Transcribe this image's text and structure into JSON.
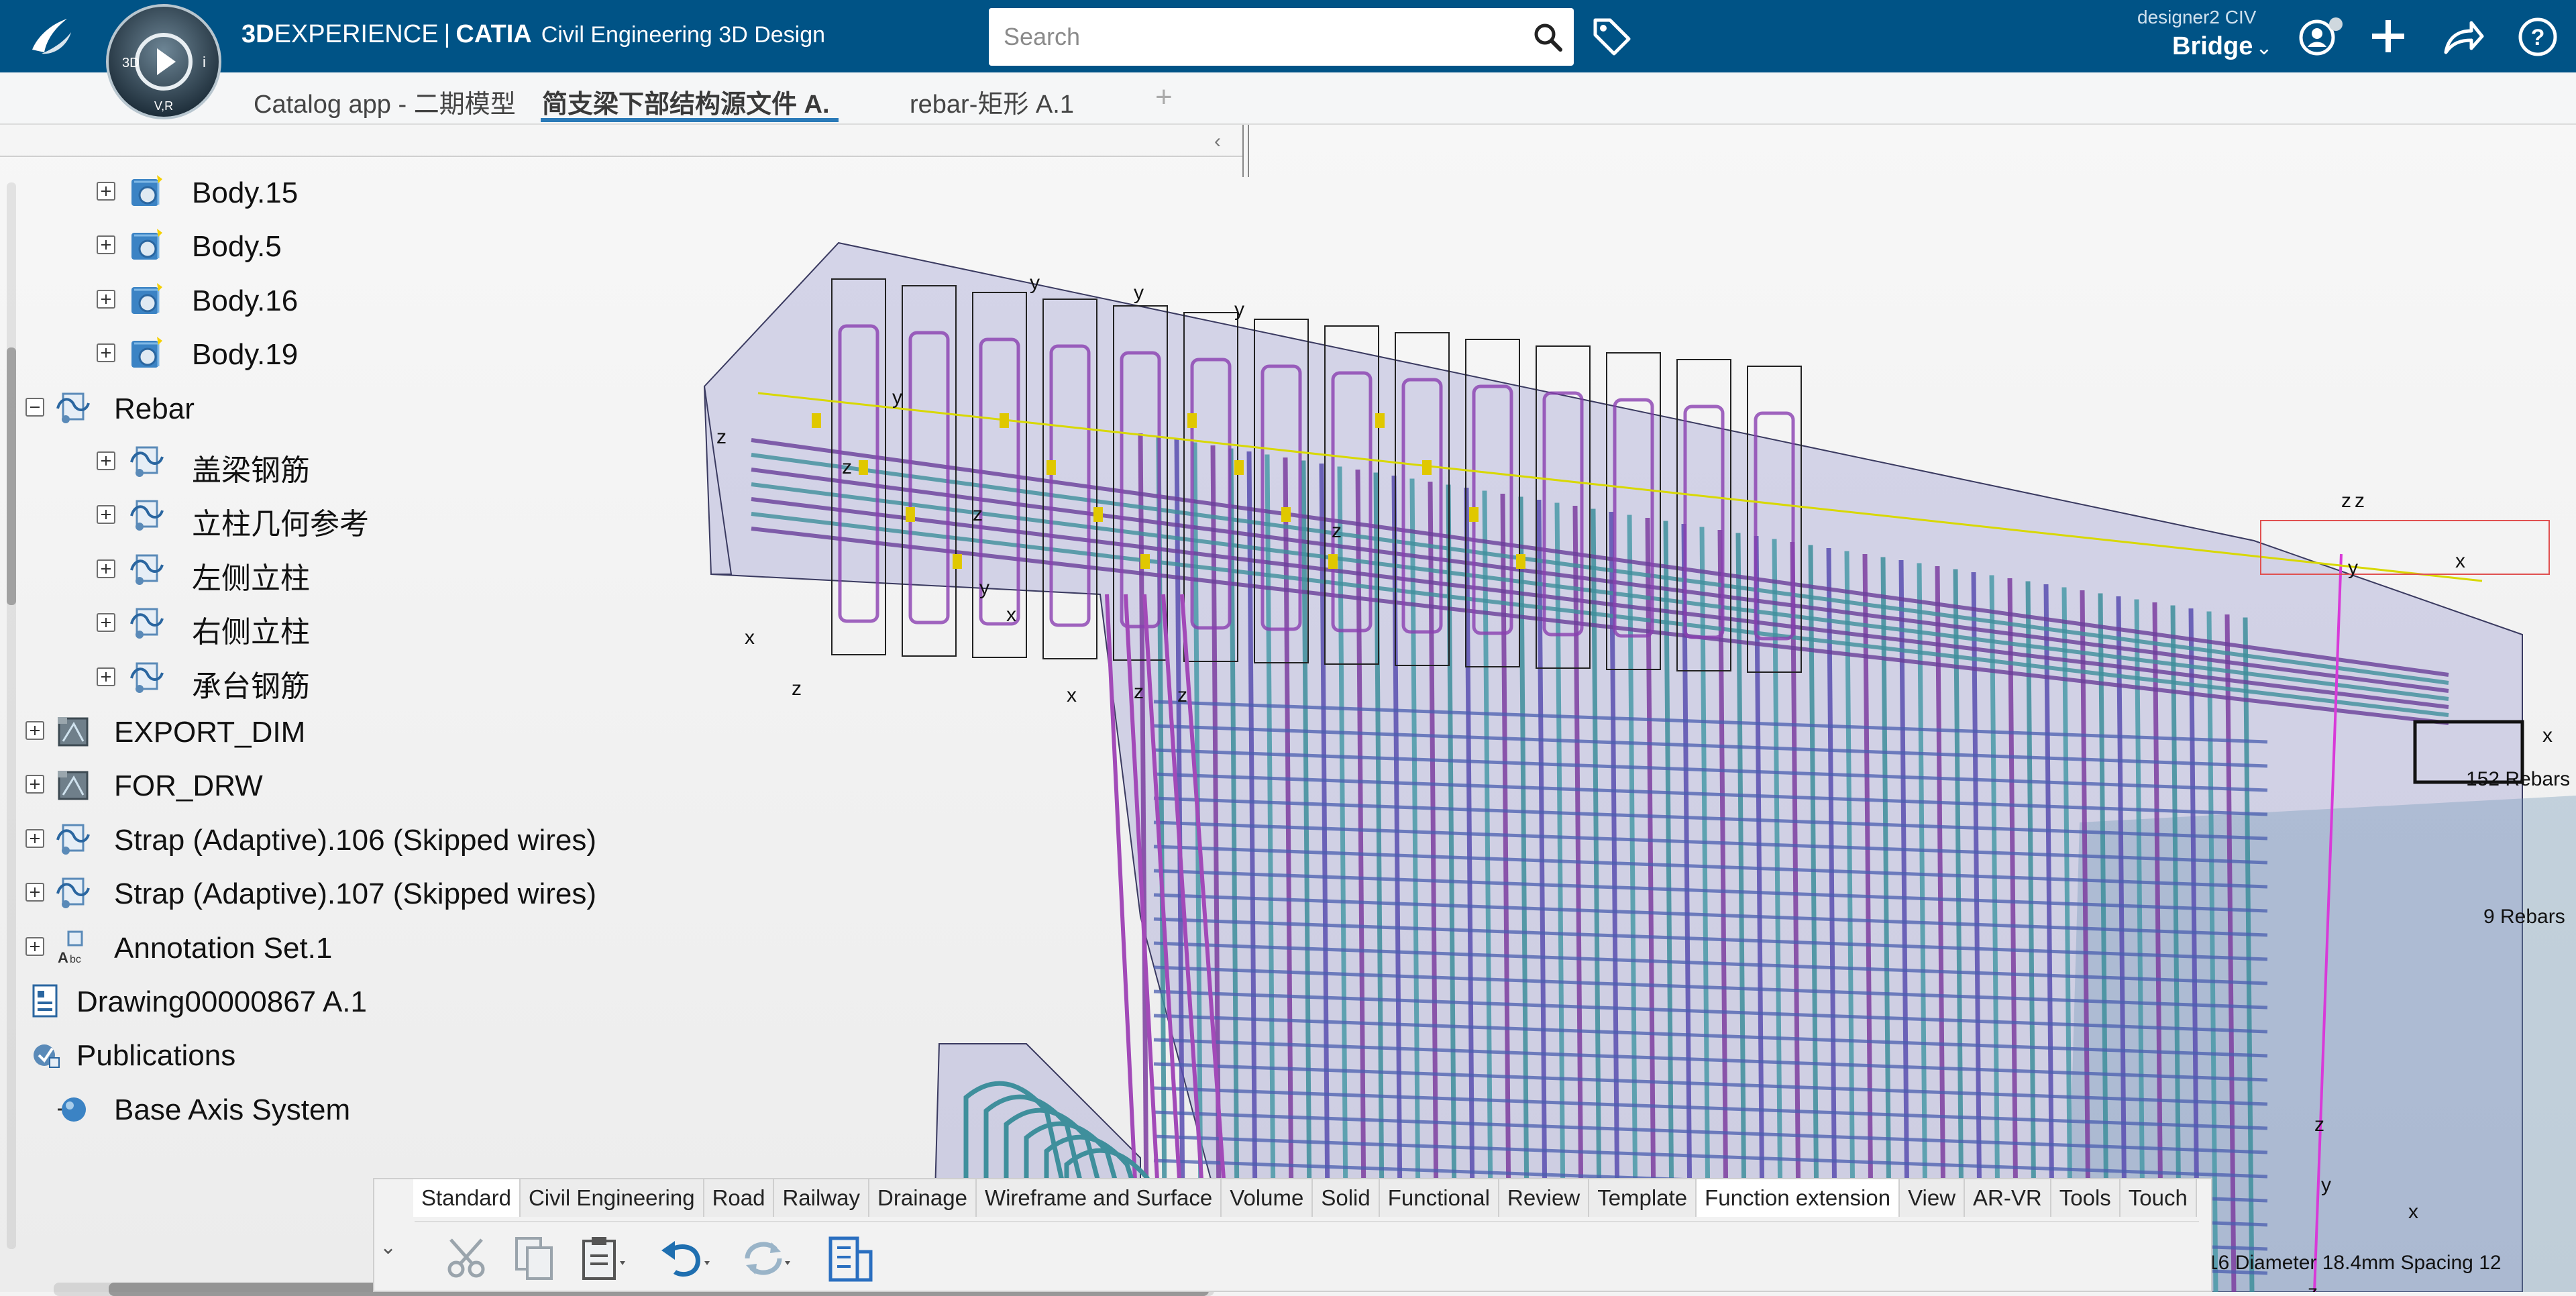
{
  "header": {
    "brand_3d": "3D",
    "brand_experience": "EXPERIENCE",
    "brand_sep": "|",
    "brand_catia": "CATIA",
    "brand_app": "Civil Engineering 3D Design",
    "search_placeholder": "Search",
    "user_name": "designer2 CIV",
    "workspace": "Bridge",
    "icons": [
      "ds-logo-icon",
      "compass-icon",
      "search-icon",
      "tag-icon",
      "user-icon",
      "plus-icon",
      "share-icon",
      "help-icon"
    ],
    "compass": {
      "top_left": "3D",
      "top_right": "i",
      "bottom": "V,R"
    },
    "accent_color": "#005386"
  },
  "tabs": [
    {
      "label": "Catalog app - 二期模型",
      "active": false
    },
    {
      "label": "简支梁下部结构源文件 A.",
      "active": true
    },
    {
      "label": "rebar-矩形 A.1",
      "active": false
    }
  ],
  "tab_add_label": "+",
  "tree_collapse_label": "‹",
  "tree": [
    {
      "label": "Body.15",
      "icon": "body-icon",
      "expander": "plus"
    },
    {
      "label": "Body.5",
      "icon": "body-icon",
      "expander": "plus"
    },
    {
      "label": "Body.16",
      "icon": "body-icon",
      "expander": "plus"
    },
    {
      "label": "Body.19",
      "icon": "body-icon",
      "expander": "plus"
    },
    {
      "label": "Rebar",
      "icon": "rebar-set-icon",
      "expander": "minus"
    },
    {
      "label": "盖梁钢筋",
      "icon": "rebar-set-icon",
      "expander": "plus"
    },
    {
      "label": "立柱几何参考",
      "icon": "rebar-set-icon",
      "expander": "plus"
    },
    {
      "label": "左侧立柱",
      "icon": "rebar-set-icon",
      "expander": "plus"
    },
    {
      "label": "右侧立柱",
      "icon": "rebar-set-icon",
      "expander": "plus"
    },
    {
      "label": "承台钢筋",
      "icon": "rebar-set-icon",
      "expander": "plus"
    },
    {
      "label": "EXPORT_DIM",
      "icon": "geometry-set-icon",
      "expander": "plus"
    },
    {
      "label": "FOR_DRW",
      "icon": "geometry-set-icon",
      "expander": "plus"
    },
    {
      "label": "Strap (Adaptive).106 (Skipped wires)",
      "icon": "rebar-set-icon",
      "expander": "plus"
    },
    {
      "label": "Strap (Adaptive).107 (Skipped wires)",
      "icon": "rebar-set-icon",
      "expander": "plus"
    },
    {
      "label": "Annotation Set.1",
      "icon": "annotation-set-icon",
      "expander": "plus"
    },
    {
      "label": "Drawing00000867 A.1",
      "icon": "drawing-icon",
      "expander": "none"
    },
    {
      "label": "Publications",
      "icon": "publications-icon",
      "expander": "none"
    },
    {
      "label": "Base Axis System",
      "icon": "axis-system-icon",
      "expander": "none"
    }
  ],
  "viewport": {
    "annotations": [
      "152 Rebars",
      "9 Rebars",
      "16 Diameter 18.4mm Spacing 12"
    ],
    "axis_letters": {
      "x": "x",
      "y": "y",
      "z": "z"
    }
  },
  "action_bar": {
    "tabs": [
      "Standard",
      "Civil Engineering",
      "Road",
      "Railway",
      "Drainage",
      "Wireframe and Surface",
      "Volume",
      "Solid",
      "Functional",
      "Review",
      "Template",
      "Function extension",
      "View",
      "AR-VR",
      "Tools",
      "Touch"
    ],
    "active_tab": "Standard",
    "chevron": "⌄",
    "tools": [
      "cut-icon",
      "copy-icon",
      "paste-icon",
      "undo-icon",
      "update-icon",
      "bridge-structure-icon"
    ]
  }
}
